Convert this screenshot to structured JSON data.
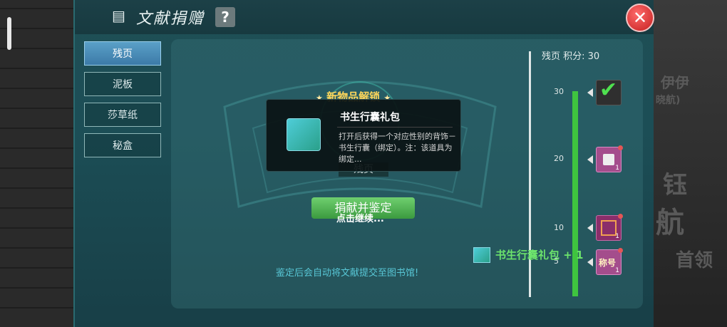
{
  "header": {
    "title": "文献捐赠",
    "help_label": "?",
    "close_label": "✕"
  },
  "tabs": [
    {
      "label": "残页",
      "active": true
    },
    {
      "label": "泥板",
      "active": false
    },
    {
      "label": "莎草纸",
      "active": false
    },
    {
      "label": "秘盒",
      "active": false
    }
  ],
  "unlock": {
    "title": "新物品解锁",
    "item_name": "书生行囊礼包",
    "description": "打开后获得一个对应性别的背饰－书生行囊（绑定）。注：该道具为绑定..."
  },
  "item_under_label": "残页",
  "donate_button": "捐献并鉴定",
  "continue_text": "点击继续...",
  "bottom_note": "鉴定后会自动将文献提交至图书馆!",
  "score": {
    "label": "残页 积分: 30",
    "value": 30
  },
  "ticks": [
    "30",
    "20",
    "10",
    "5"
  ],
  "rewards": [
    {
      "name": "check-reward",
      "count": "",
      "claimed": true
    },
    {
      "name": "gift-reward",
      "count": "1",
      "claimed": false
    },
    {
      "name": "frame-reward",
      "count": "1",
      "claimed": false
    },
    {
      "name": "title-reward",
      "count": "1",
      "label": "称号",
      "claimed": false
    }
  ],
  "gain_text": "书生行囊礼包 + 1",
  "background_text": [
    "伊伊",
    "晓航)",
    "钰",
    "航",
    "首领"
  ],
  "colors": {
    "progress": "#3fc43f",
    "accent": "#ffd65a",
    "note": "#58c7d6"
  }
}
